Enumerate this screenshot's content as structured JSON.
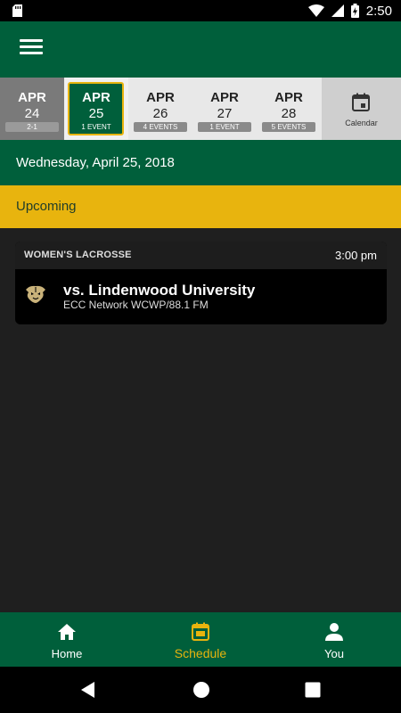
{
  "status_bar": {
    "time": "2:50"
  },
  "date_strip": {
    "days": [
      {
        "month": "APR",
        "day": "24",
        "badge": "2-1",
        "state": "past"
      },
      {
        "month": "APR",
        "day": "25",
        "badge": "1 EVENT",
        "state": "selected"
      },
      {
        "month": "APR",
        "day": "26",
        "badge": "4 EVENTS",
        "state": "normal"
      },
      {
        "month": "APR",
        "day": "27",
        "badge": "1 EVENT",
        "state": "normal"
      },
      {
        "month": "APR",
        "day": "28",
        "badge": "5 EVENTS",
        "state": "normal"
      }
    ],
    "calendar_label": "Calendar"
  },
  "date_header": "Wednesday, April 25, 2018",
  "section_label": "Upcoming",
  "event": {
    "sport": "WOMEN'S LACROSSE",
    "time": "3:00 pm",
    "opponent": "vs. Lindenwood University",
    "network": "ECC Network WCWP/88.1 FM"
  },
  "bottom_nav": {
    "items": [
      {
        "label": "Home",
        "icon": "home-icon",
        "active": false
      },
      {
        "label": "Schedule",
        "icon": "schedule-icon",
        "active": true
      },
      {
        "label": "You",
        "icon": "person-icon",
        "active": false
      }
    ]
  },
  "colors": {
    "primary": "#005f3b",
    "accent": "#e8b40e",
    "background": "#1f1f1f"
  }
}
